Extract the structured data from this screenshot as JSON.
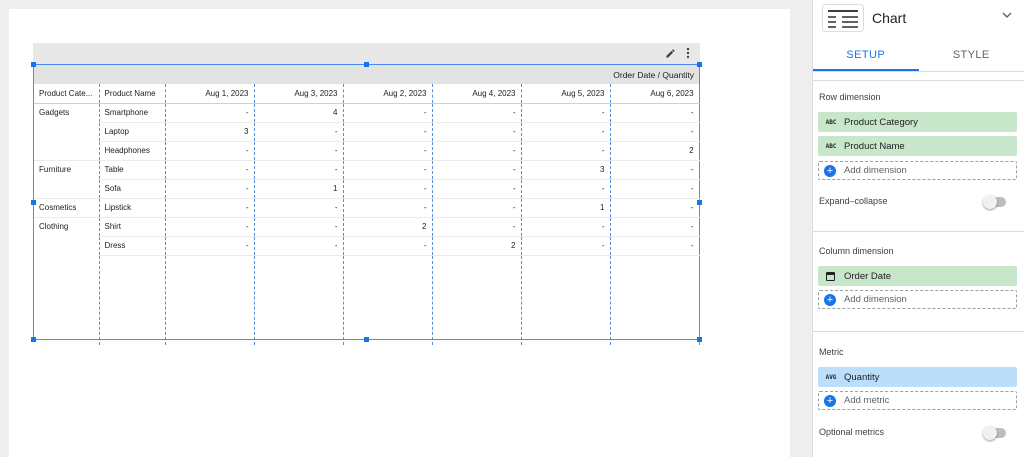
{
  "chart": {
    "header_band": "Order Date / Quantity",
    "columns": [
      "Product Cate...",
      "Product Name",
      "Aug 1, 2023",
      "Aug 3, 2023",
      "Aug 2, 2023",
      "Aug 4, 2023",
      "Aug 5, 2023",
      "Aug 6, 2023"
    ],
    "rows": [
      {
        "category": "Gadgets",
        "product": "Smartphone",
        "values": [
          "-",
          "4",
          "-",
          "-",
          "-",
          "-"
        ]
      },
      {
        "category": "",
        "product": "Laptop",
        "values": [
          "3",
          "-",
          "-",
          "-",
          "-",
          "-"
        ]
      },
      {
        "category": "",
        "product": "Headphones",
        "values": [
          "-",
          "-",
          "-",
          "-",
          "-",
          "2"
        ]
      },
      {
        "category": "Furniture",
        "product": "Table",
        "values": [
          "-",
          "-",
          "-",
          "-",
          "3",
          "-"
        ]
      },
      {
        "category": "",
        "product": "Sofa",
        "values": [
          "-",
          "1",
          "-",
          "-",
          "-",
          "-"
        ]
      },
      {
        "category": "Cosmetics",
        "product": "Lipstick",
        "values": [
          "-",
          "-",
          "-",
          "-",
          "1",
          "-"
        ]
      },
      {
        "category": "Clothing",
        "product": "Shirt",
        "values": [
          "-",
          "-",
          "2",
          "-",
          "-",
          "-"
        ]
      },
      {
        "category": "",
        "product": "Dress",
        "values": [
          "-",
          "-",
          "-",
          "2",
          "-",
          "-"
        ]
      }
    ]
  },
  "panel": {
    "title": "Chart",
    "tabs": [
      "SETUP",
      "STYLE"
    ],
    "row_dimension": {
      "label": "Row dimension",
      "chips": [
        {
          "type": "ABC",
          "name": "Product Category"
        },
        {
          "type": "ABC",
          "name": "Product Name"
        }
      ],
      "add_label": "Add dimension"
    },
    "expand_collapse": {
      "label": "Expand–collapse",
      "enabled": false
    },
    "column_dimension": {
      "label": "Column dimension",
      "chip": {
        "icon": "calendar-icon",
        "name": "Order Date"
      },
      "add_label": "Add dimension"
    },
    "metric": {
      "label": "Metric",
      "chip": {
        "type": "AVG",
        "name": "Quantity"
      },
      "add_label": "Add metric"
    },
    "optional_metrics": {
      "label": "Optional metrics",
      "enabled": false
    }
  },
  "colors": {
    "accent": "#1a73e8",
    "dimension_chip": "#c8e6c9",
    "metric_chip": "#bbdefb"
  }
}
